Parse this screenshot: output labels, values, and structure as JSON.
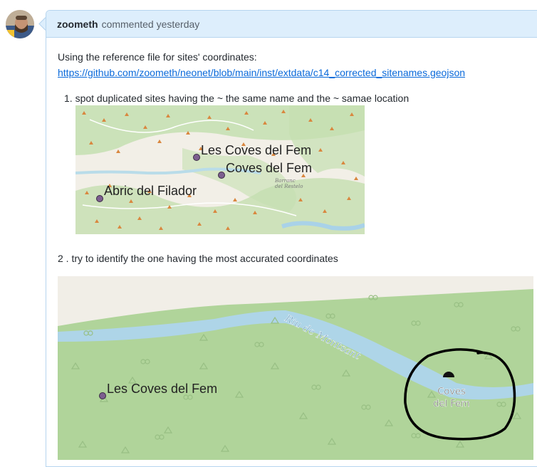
{
  "comment": {
    "author": "zoometh",
    "meta": "commented yesterday",
    "intro": "Using the reference file for sites' coordinates:",
    "link": "https://github.com/zoometh/neonet/blob/main/inst/extdata/c14_corrected_sitenames.geojson",
    "step1_number": "1.",
    "step1": "spot duplicated sites having the ~ the same name and the ~ samae location",
    "step2": "2 . try to identify the one having the most accurated coordinates"
  },
  "map1": {
    "labels": [
      "Les Coves del Fem",
      "Coves del Fem",
      "Abric del Filador"
    ],
    "place_label": [
      "Barranc",
      "del Restelo"
    ]
  },
  "map2": {
    "site_label": "Les Coves del Fem",
    "river_label": "Riu de Montsant",
    "poi_label": [
      "Coves",
      "del Fem"
    ]
  },
  "colors": {
    "header_bg": "#ddeefc",
    "border": "#b6d5ef",
    "link": "#0969da",
    "map_green": "#b0d49a",
    "river": "#aed5e8",
    "site_marker": "#7d5f8f"
  }
}
